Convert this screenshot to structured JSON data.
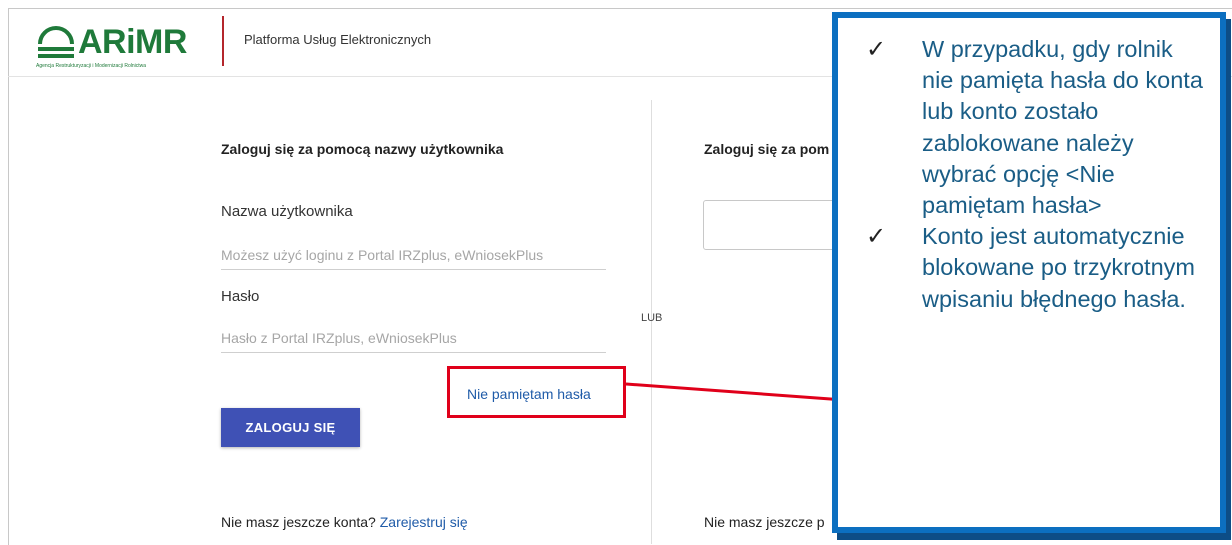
{
  "header": {
    "logo_text": "ARiMR",
    "logo_subtitle": "Agencja Restrukturyzacji i Modernizacji Rolnictwa",
    "platform_title": "Platforma Usług Elektronicznych"
  },
  "login_left": {
    "section_title": "Zaloguj się za pomocą nazwy użytkownika",
    "username_label": "Nazwa użytkownika",
    "username_placeholder": "Możesz użyć loginu z Portal IRZplus, eWniosekPlus",
    "password_label": "Hasło",
    "password_placeholder": "Hasło z Portal IRZplus, eWniosekPlus",
    "forgot_link": "Nie pamiętam hasła",
    "login_button": "ZALOGUJ SIĘ",
    "register_prompt": "Nie masz jeszcze konta?",
    "register_link": "Zarejestruj się"
  },
  "or_divider": "LUB",
  "login_right": {
    "section_title": "Zaloguj się za pom",
    "register_prompt": "Nie masz jeszcze p"
  },
  "callout": {
    "items": [
      "W przypadku, gdy rolnik nie pamięta hasła do konta lub konto zostało zablokowane należy wybrać opcję <Nie pamiętam hasła>",
      "Konto jest automatycznie blokowane po trzykrotnym wpisaniu błędnego hasła."
    ],
    "check_icon": "✓"
  },
  "colors": {
    "brand_green": "#1f7a3a",
    "header_divider": "#b4262c",
    "button_blue": "#3f51b5",
    "link_blue": "#1f5ba8",
    "highlight_red": "#e0001a",
    "callout_border": "#0c6fc0",
    "callout_text": "#1a5d86"
  }
}
